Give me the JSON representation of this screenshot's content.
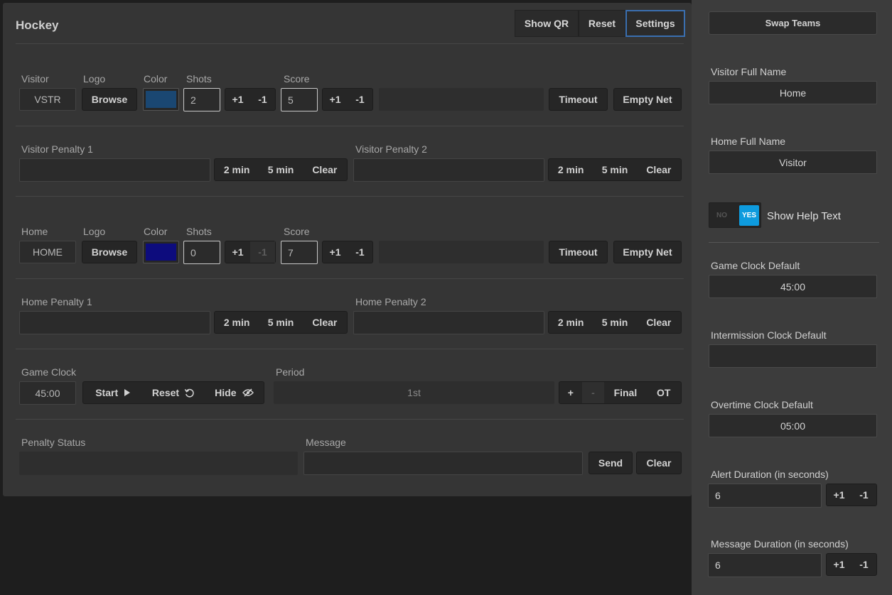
{
  "header": {
    "title": "Hockey",
    "show_qr": "Show QR",
    "reset": "Reset",
    "settings": "Settings"
  },
  "visitor": {
    "section_label": "Visitor",
    "logo_label": "Logo",
    "color_label": "Color",
    "shots_label": "Shots",
    "score_label": "Score",
    "abbr": "VSTR",
    "browse": "Browse",
    "color": "#1a4772",
    "shots": "2",
    "score": "5",
    "plus": "+1",
    "minus": "-1",
    "timeout": "Timeout",
    "empty_net": "Empty Net",
    "penalty1_label": "Visitor Penalty 1",
    "penalty2_label": "Visitor Penalty 2"
  },
  "home": {
    "section_label": "Home",
    "logo_label": "Logo",
    "color_label": "Color",
    "shots_label": "Shots",
    "score_label": "Score",
    "abbr": "HOME",
    "browse": "Browse",
    "color": "#0d0c7d",
    "shots": "0",
    "score": "7",
    "plus": "+1",
    "minus": "-1",
    "timeout": "Timeout",
    "empty_net": "Empty Net",
    "penalty1_label": "Home Penalty 1",
    "penalty2_label": "Home Penalty 2"
  },
  "penalty_buttons": {
    "two": "2 min",
    "five": "5 min",
    "clear": "Clear"
  },
  "clock": {
    "label": "Game Clock",
    "value": "45:00",
    "start": "Start",
    "reset": "Reset",
    "hide": "Hide",
    "period_label": "Period",
    "period": "1st",
    "plus": "+",
    "minus": "-",
    "final": "Final",
    "ot": "OT"
  },
  "footer": {
    "penalty_status_label": "Penalty Status",
    "message_label": "Message",
    "send": "Send",
    "clear": "Clear"
  },
  "settings_panel": {
    "swap": "Swap Teams",
    "visitor_full_label": "Visitor Full Name",
    "visitor_full": "Home",
    "home_full_label": "Home Full Name",
    "home_full": "Visitor",
    "toggle_no": "NO",
    "toggle_yes": "YES",
    "help_text_label": "Show Help Text",
    "game_clock_label": "Game Clock Default",
    "game_clock": "45:00",
    "intermission_label": "Intermission Clock Default",
    "intermission": "",
    "overtime_label": "Overtime Clock Default",
    "overtime": "05:00",
    "alert_label": "Alert Duration (in seconds)",
    "alert": "6",
    "message_label": "Message Duration (in seconds)",
    "message": "6",
    "plus": "+1",
    "minus": "-1"
  },
  "colors": {
    "accent": "#0e9bde",
    "selected_border": "#3a6fb0"
  }
}
